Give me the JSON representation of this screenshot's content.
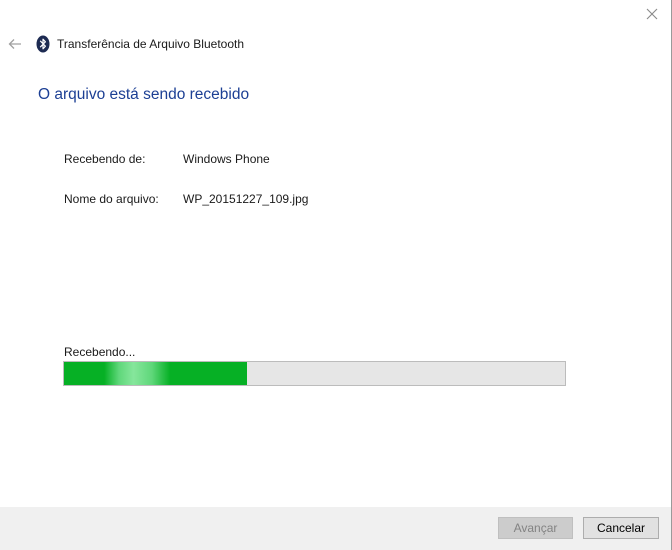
{
  "window": {
    "title": "Transferência de Arquivo Bluetooth",
    "heading": "O arquivo está sendo recebido"
  },
  "details": {
    "from_label": "Recebendo de:",
    "from_value": "Windows Phone",
    "file_label": "Nome do arquivo:",
    "file_value": "WP_20151227_109.jpg"
  },
  "progress": {
    "status": "Recebendo...",
    "fraction": 0.366
  },
  "buttons": {
    "next_label": "Avançar",
    "cancel_label": "Cancelar"
  },
  "icons": {
    "close": "close-icon",
    "back": "back-arrow-icon",
    "bluetooth": "bluetooth-icon"
  },
  "colors": {
    "heading": "#1c3f94",
    "progress_fill": "#06b025",
    "progress_track": "#e6e6e6",
    "bluetooth_badge": "#1d2b52"
  }
}
